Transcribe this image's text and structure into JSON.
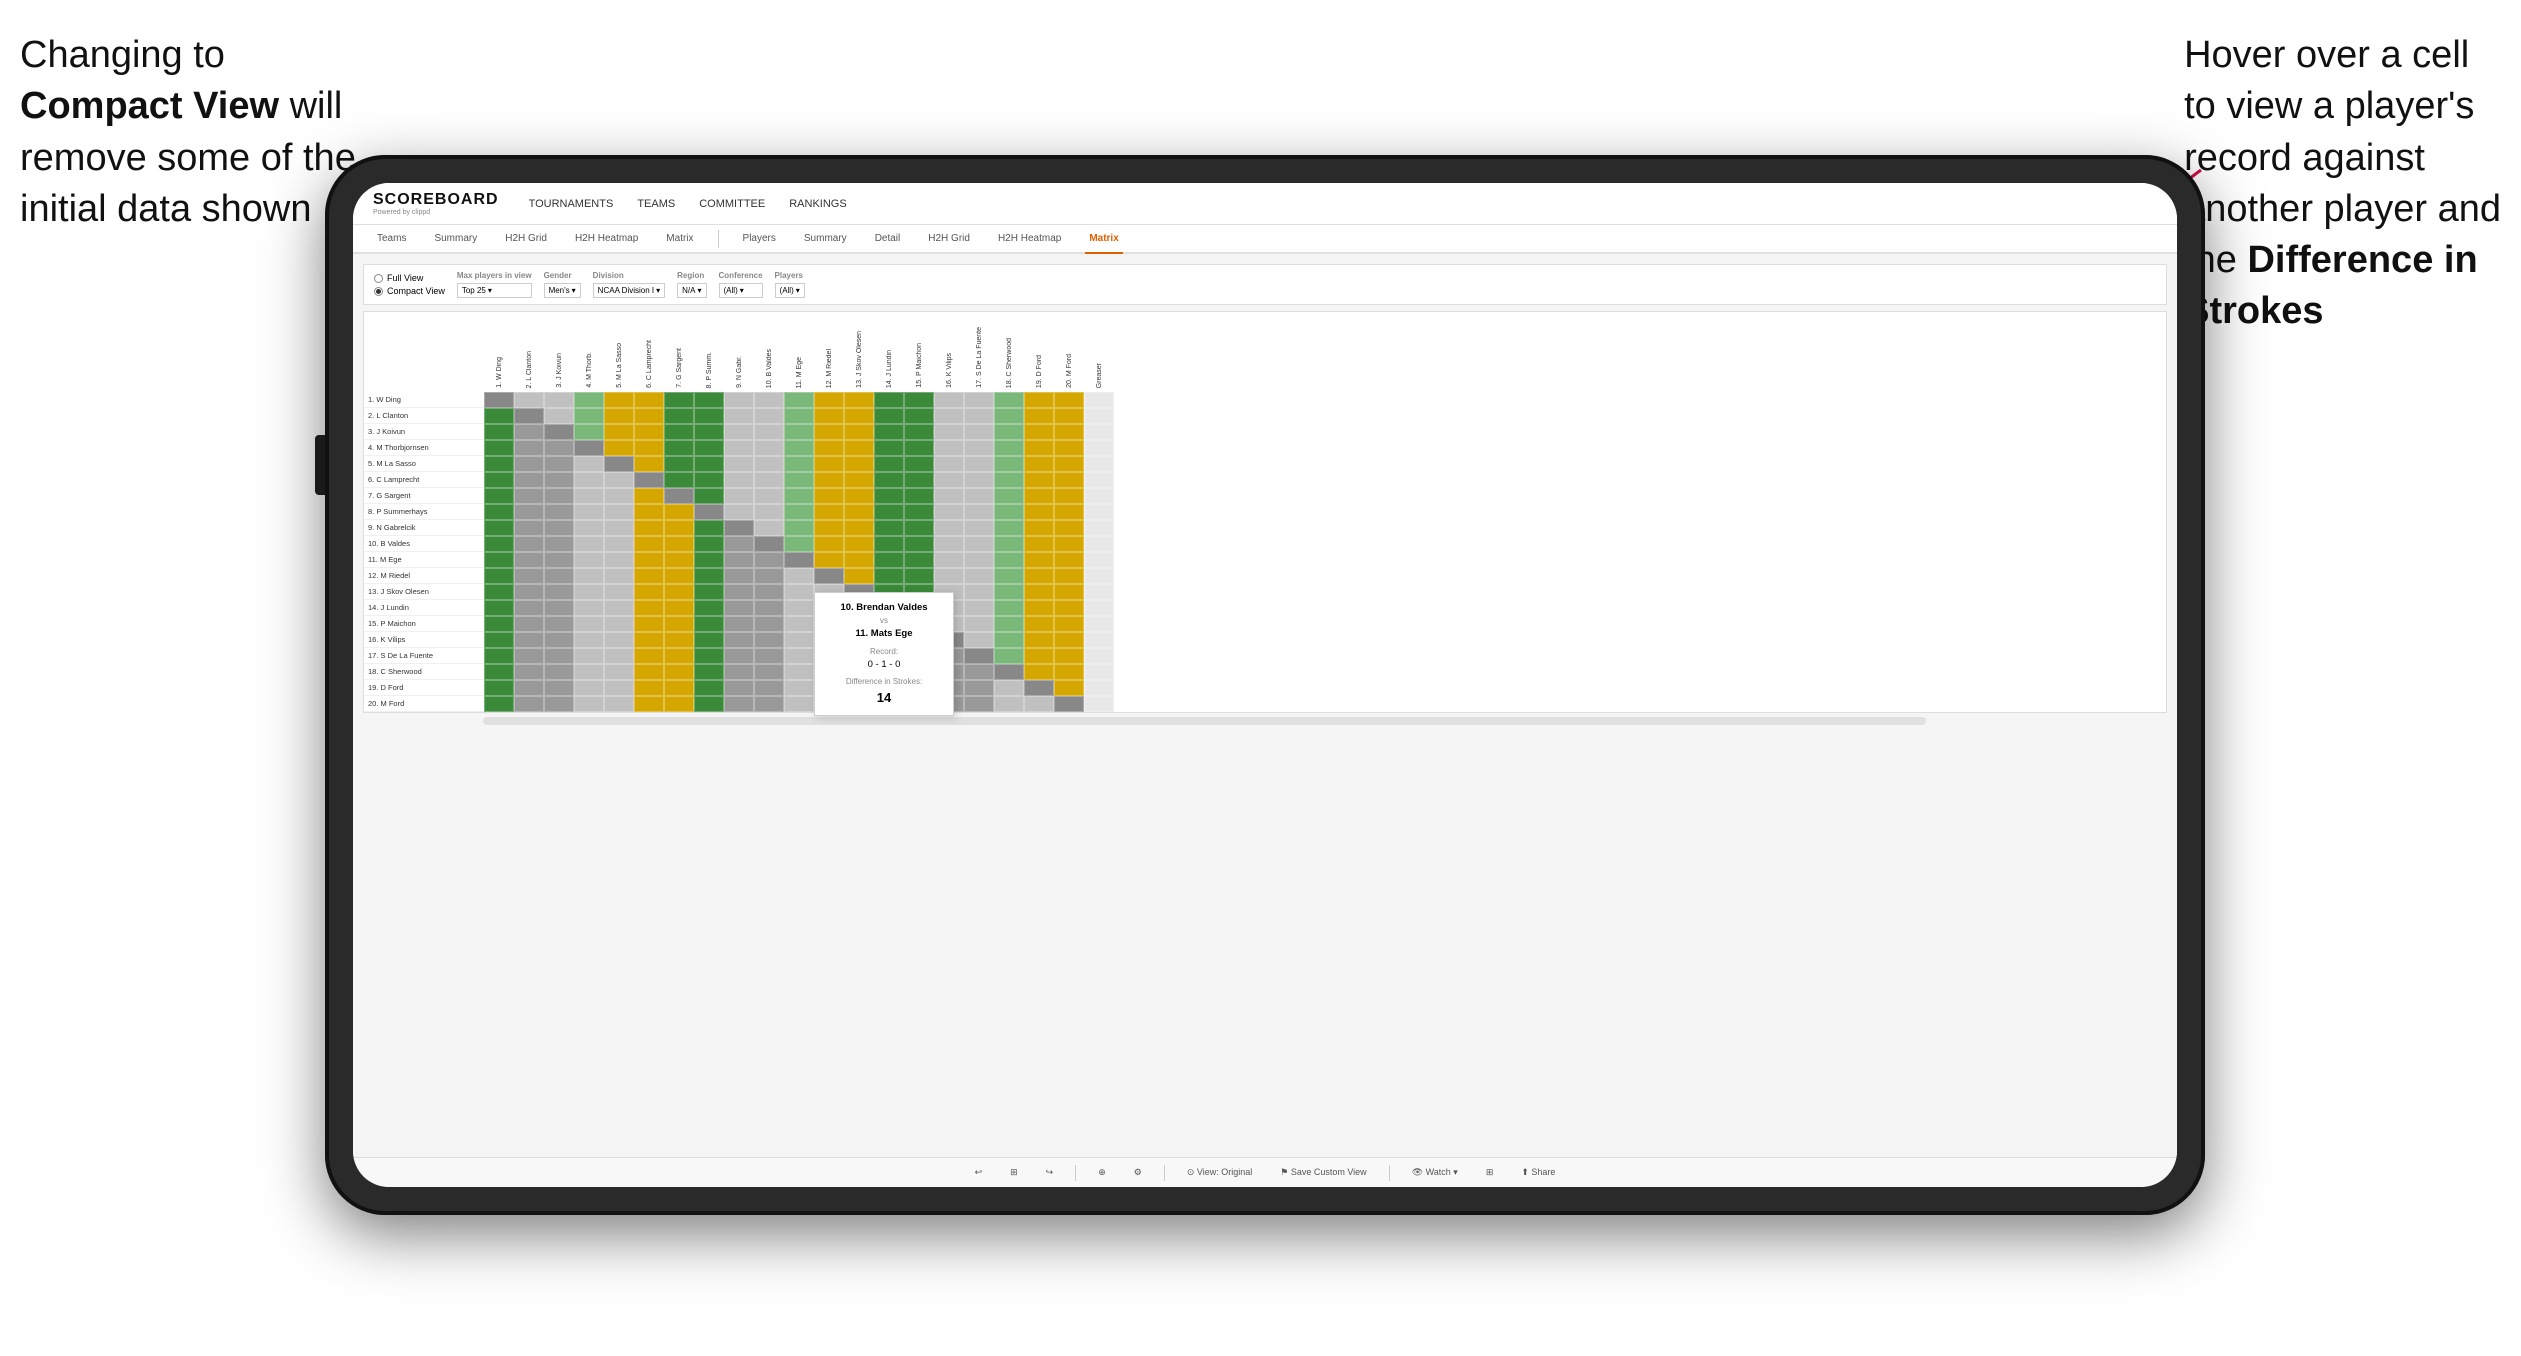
{
  "annotations": {
    "left": {
      "line1": "Changing to",
      "line2bold": "Compact View",
      "line2rest": " will",
      "line3": "remove some of the",
      "line4": "initial data shown"
    },
    "right": {
      "line1": "Hover over a cell",
      "line2": "to view a player's",
      "line3": "record against",
      "line4": "another player and",
      "line5": "the ",
      "line5bold": "Difference in",
      "line6bold": "Strokes"
    }
  },
  "nav": {
    "logo": "SCOREBOARD",
    "logo_sub": "Powered by clippd",
    "links": [
      "TOURNAMENTS",
      "TEAMS",
      "COMMITTEE",
      "RANKINGS"
    ]
  },
  "tabs": {
    "group1": [
      "Teams",
      "Summary",
      "H2H Grid",
      "H2H Heatmap",
      "Matrix"
    ],
    "group2": [
      "Players",
      "Summary",
      "Detail",
      "H2H Grid",
      "H2H Heatmap",
      "Matrix"
    ],
    "active": "Matrix"
  },
  "filters": {
    "view_label": "Full View",
    "view_compact": "Compact View",
    "max_players_label": "Max players in view",
    "max_players_value": "Top 25",
    "gender_label": "Gender",
    "gender_value": "Men's",
    "division_label": "Division",
    "division_value": "NCAA Division I",
    "region_label": "Region",
    "region_value": "N/A",
    "conference_label": "Conference",
    "conference_value": "(All)",
    "players_label": "Players",
    "players_value": "(All)"
  },
  "players": [
    "1. W Ding",
    "2. L Clanton",
    "3. J Koivun",
    "4. M Thorbjornsen",
    "5. M La Sasso",
    "6. C Lamprecht",
    "7. G Sargent",
    "8. P Summerhays",
    "9. N Gabrelcik",
    "10. B Valdes",
    "11. M Ege",
    "12. M Riedel",
    "13. J Skov Olesen",
    "14. J Lundin",
    "15. P Maichon",
    "16. K Vilips",
    "17. S De La Fuente",
    "18. C Sherwood",
    "19. D Ford",
    "20. M Ford"
  ],
  "col_headers": [
    "1. W Ding",
    "2. L Clanton",
    "3. J Koivun",
    "4. M Thorb.",
    "5. M La Sasso",
    "6. C Lamprecht",
    "7. G Sargent",
    "8. P Summ.",
    "9. N Gabr.",
    "10. B Valdes",
    "11. M Ege",
    "12. M Riedel",
    "13. J Skov Olesen",
    "14. J Lundin",
    "15. P Maichon",
    "16. K Vilips",
    "17. S De La Fuente",
    "18. C Sherwood",
    "19. D Ford",
    "20. M Ford",
    "Greaser"
  ],
  "tooltip": {
    "player1": "10. Brendan Valdes",
    "vs": "vs",
    "player2": "11. Mats Ege",
    "record_label": "Record:",
    "record": "0 - 1 - 0",
    "strokes_label": "Difference in Strokes:",
    "strokes": "14"
  },
  "toolbar": {
    "undo": "↩",
    "redo": "↪",
    "view_original": "⊙ View: Original",
    "save_custom": "⚑ Save Custom View",
    "watch": "👁 Watch ▾",
    "share": "⬆ Share"
  }
}
